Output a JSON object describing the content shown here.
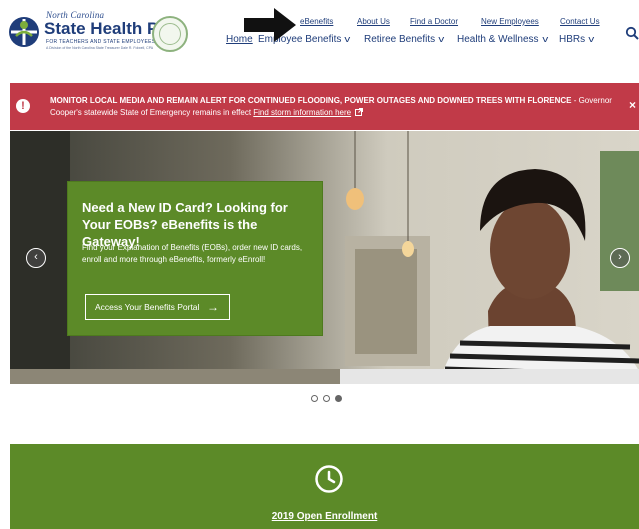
{
  "logo": {
    "line1": "North Carolina",
    "line2": "State Health Plan",
    "line3": "FOR TEACHERS AND STATE EMPLOYEES",
    "line4": "A Division of the North Carolina State Treasurer Dale R. Folwell, CPA"
  },
  "top_links": [
    {
      "label": "eBenefits"
    },
    {
      "label": "About Us"
    },
    {
      "label": "Find a Doctor"
    },
    {
      "label": "New Employees"
    },
    {
      "label": "Contact Us"
    }
  ],
  "main_nav": [
    {
      "label": "Home"
    },
    {
      "label": "Employee Benefits"
    },
    {
      "label": "Retiree Benefits"
    },
    {
      "label": "Health & Wellness"
    },
    {
      "label": "HBRs"
    }
  ],
  "alert": {
    "strong": "MONITOR LOCAL MEDIA AND REMAIN ALERT FOR CONTINUED FLOODING, POWER OUTAGES AND DOWNED TREES WITH FLORENCE",
    "rest": " - Governor Cooper's statewide State of Emergency remains in effect ",
    "link": "Find storm information here",
    "close": "×"
  },
  "hero": {
    "promo_title": "Need a New ID Card? Looking for Your EOBs? eBenefits is the Gateway!",
    "promo_body": "Find your Explanation of Benefits (EOBs), order new ID cards, enroll and more through eBenefits, formerly eEnroll!",
    "button_label": "Access Your Benefits Portal",
    "button_arrow": "→",
    "prev": "‹",
    "next": "›"
  },
  "carousel": {
    "slide_count": 3,
    "active_index": 2
  },
  "enrollment": {
    "title": "2019 Open Enrollment"
  },
  "colors": {
    "brand_blue": "#1f3d7a",
    "alert_red": "#c13a48",
    "green": "#5c8a28"
  },
  "icons": [
    "logo-mark-icon",
    "seal-icon",
    "search-icon",
    "arrow-annotation-icon",
    "alert-icon",
    "close-icon",
    "chevron-left-icon",
    "chevron-right-icon",
    "external-link-icon",
    "clock-icon"
  ]
}
